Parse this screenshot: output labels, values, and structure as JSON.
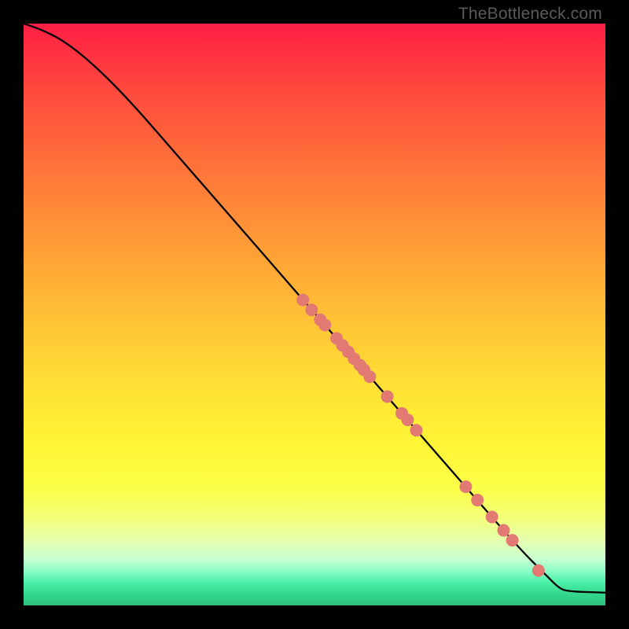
{
  "watermark": "TheBottleneck.com",
  "chart_data": {
    "type": "line",
    "title": "",
    "xlabel": "",
    "ylabel": "",
    "xlim": [
      0,
      100
    ],
    "ylim": [
      0,
      100
    ],
    "curve": [
      {
        "x": 0,
        "y": 100
      },
      {
        "x": 3,
        "y": 99
      },
      {
        "x": 7,
        "y": 97
      },
      {
        "x": 12,
        "y": 93
      },
      {
        "x": 18,
        "y": 87
      },
      {
        "x": 25,
        "y": 79
      },
      {
        "x": 35,
        "y": 67.5
      },
      {
        "x": 45,
        "y": 56
      },
      {
        "x": 55,
        "y": 44.5
      },
      {
        "x": 65,
        "y": 33
      },
      {
        "x": 75,
        "y": 21.5
      },
      {
        "x": 85,
        "y": 10
      },
      {
        "x": 90,
        "y": 5
      },
      {
        "x": 92,
        "y": 3
      },
      {
        "x": 93.5,
        "y": 2.4
      },
      {
        "x": 100,
        "y": 2.2
      }
    ],
    "points": [
      {
        "x": 48,
        "y": 52.5
      },
      {
        "x": 49.5,
        "y": 50.8
      },
      {
        "x": 51,
        "y": 49.1
      },
      {
        "x": 51.8,
        "y": 48.2
      },
      {
        "x": 53.8,
        "y": 45.9
      },
      {
        "x": 54.8,
        "y": 44.7
      },
      {
        "x": 55.8,
        "y": 43.6
      },
      {
        "x": 56.8,
        "y": 42.4
      },
      {
        "x": 57.8,
        "y": 41.3
      },
      {
        "x": 58.5,
        "y": 40.5
      },
      {
        "x": 59.5,
        "y": 39.3
      },
      {
        "x": 62.5,
        "y": 35.9
      },
      {
        "x": 65,
        "y": 33.0
      },
      {
        "x": 66,
        "y": 31.9
      },
      {
        "x": 67.5,
        "y": 30.1
      },
      {
        "x": 76,
        "y": 20.4
      },
      {
        "x": 78,
        "y": 18.1
      },
      {
        "x": 80.5,
        "y": 15.2
      },
      {
        "x": 82.5,
        "y": 12.9
      },
      {
        "x": 84,
        "y": 11.2
      },
      {
        "x": 88.5,
        "y": 6.0
      }
    ],
    "dot_radius_px": 8,
    "dot_color": "#e27a73",
    "curve_color": "#000000"
  }
}
